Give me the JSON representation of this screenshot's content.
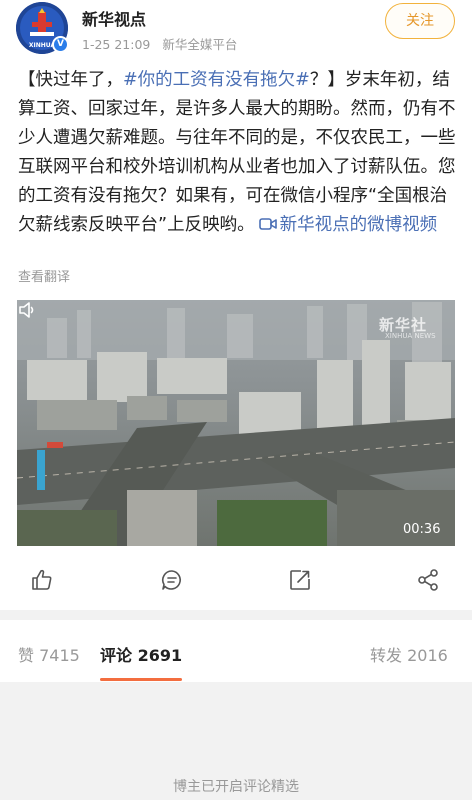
{
  "header": {
    "author": "新华视点",
    "time": "1-25 21:09",
    "source": "新华全媒平台",
    "follow_label": "关注",
    "avatar_text": "XINHUA",
    "verified_mark": "V"
  },
  "post": {
    "text_open": "【快过年了，",
    "hashtag": "#你的工资有没有拖欠#",
    "text_body": "？】岁末年初，结算工资、回家过年，是许多人最大的期盼。然而，仍有不少人遭遇欠薪难题。与往年不同的是，不仅农民工，一些互联网平台和校外培训机构从业者也加入了讨薪队伍。您的工资有没有拖欠？如果有，可在微信小程序“全国根治欠薪线索反映平台”上反映哟。",
    "video_link_label": "新华视点的微博视频",
    "translate_label": "查看翻译"
  },
  "video": {
    "watermark": "新华社",
    "watermark_sub": "XINHUA NEWS",
    "duration": "00:36"
  },
  "actions": {
    "like_icon": "thumbs-up-icon",
    "comment_icon": "comment-icon",
    "repost_icon": "repost-icon",
    "share_icon": "share-icon"
  },
  "tabs": {
    "likes": "赞 7415",
    "comments": "评论 2691",
    "reposts": "转发 2016"
  },
  "notice": "博主已开启评论精选",
  "colors": {
    "accent": "#f36d3f",
    "follow": "#e5972a",
    "link": "#4a6fb5"
  }
}
